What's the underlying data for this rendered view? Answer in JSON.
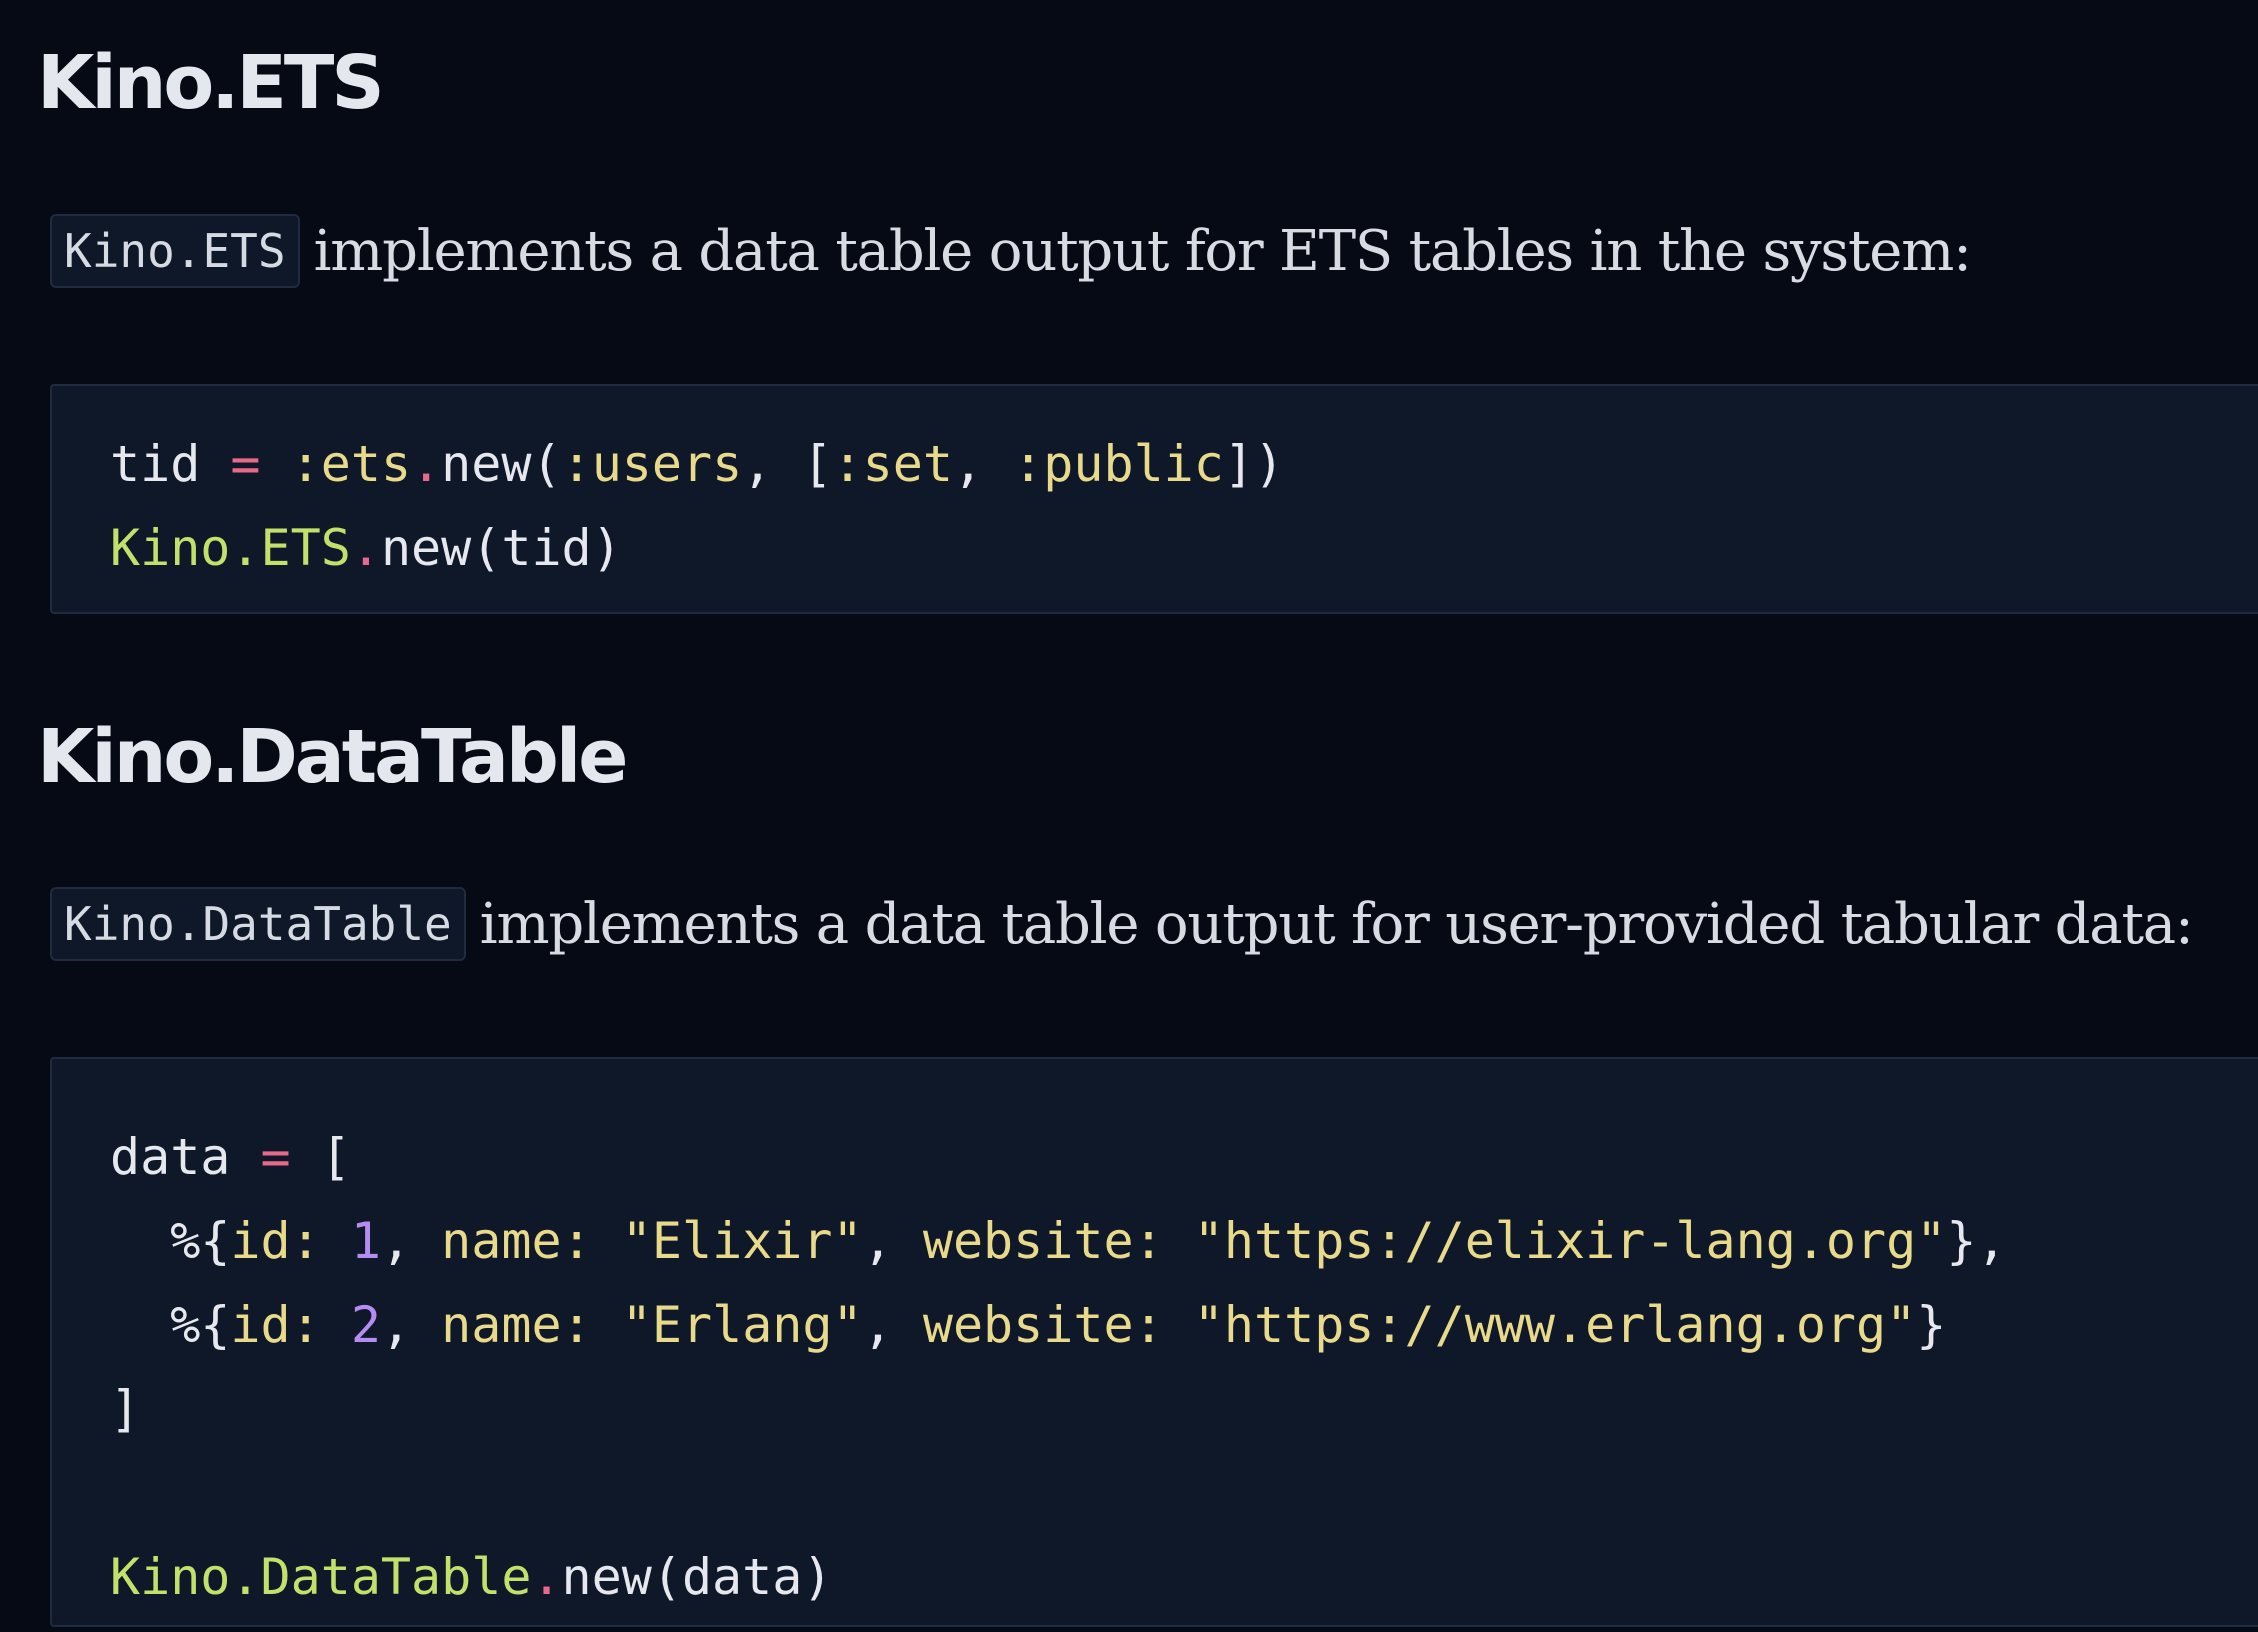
{
  "sections": [
    {
      "heading": "Kino.ETS",
      "inline_code": "Kino.ETS",
      "description": "implements a data table output for ETS tables in the system:",
      "code_lines": [
        [
          {
            "t": "tid",
            "k": "id"
          },
          {
            "t": " ",
            "k": "punc"
          },
          {
            "t": "=",
            "k": "op"
          },
          {
            "t": " ",
            "k": "punc"
          },
          {
            "t": ":ets",
            "k": "atom"
          },
          {
            "t": ".",
            "k": "op"
          },
          {
            "t": "new(",
            "k": "id"
          },
          {
            "t": ":users",
            "k": "atom"
          },
          {
            "t": ", [",
            "k": "punc"
          },
          {
            "t": ":set",
            "k": "atom"
          },
          {
            "t": ", ",
            "k": "punc"
          },
          {
            "t": ":public",
            "k": "atom"
          },
          {
            "t": "])",
            "k": "punc"
          }
        ],
        [
          {
            "t": "Kino.ETS",
            "k": "module"
          },
          {
            "t": ".",
            "k": "op"
          },
          {
            "t": "new(tid)",
            "k": "id"
          }
        ]
      ]
    },
    {
      "heading": "Kino.DataTable",
      "inline_code": "Kino.DataTable",
      "description": "implements a data table output for user-provided tabular data:",
      "code_lines": [
        [
          {
            "t": "data",
            "k": "id"
          },
          {
            "t": " ",
            "k": "punc"
          },
          {
            "t": "=",
            "k": "op"
          },
          {
            "t": " [",
            "k": "punc"
          }
        ],
        [
          {
            "t": "  %{",
            "k": "punc"
          },
          {
            "t": "id:",
            "k": "atom"
          },
          {
            "t": " ",
            "k": "punc"
          },
          {
            "t": "1",
            "k": "num"
          },
          {
            "t": ", ",
            "k": "punc"
          },
          {
            "t": "name:",
            "k": "atom"
          },
          {
            "t": " ",
            "k": "punc"
          },
          {
            "t": "\"Elixir\"",
            "k": "str"
          },
          {
            "t": ", ",
            "k": "punc"
          },
          {
            "t": "website:",
            "k": "atom"
          },
          {
            "t": " ",
            "k": "punc"
          },
          {
            "t": "\"https://elixir-lang.org\"",
            "k": "str"
          },
          {
            "t": "},",
            "k": "punc"
          }
        ],
        [
          {
            "t": "  %{",
            "k": "punc"
          },
          {
            "t": "id:",
            "k": "atom"
          },
          {
            "t": " ",
            "k": "punc"
          },
          {
            "t": "2",
            "k": "num"
          },
          {
            "t": ", ",
            "k": "punc"
          },
          {
            "t": "name:",
            "k": "atom"
          },
          {
            "t": " ",
            "k": "punc"
          },
          {
            "t": "\"Erlang\"",
            "k": "str"
          },
          {
            "t": ", ",
            "k": "punc"
          },
          {
            "t": "website:",
            "k": "atom"
          },
          {
            "t": " ",
            "k": "punc"
          },
          {
            "t": "\"https://www.erlang.org\"",
            "k": "str"
          },
          {
            "t": "}",
            "k": "punc"
          }
        ],
        [
          {
            "t": "]",
            "k": "punc"
          }
        ],
        [],
        [
          {
            "t": "Kino.DataTable",
            "k": "module"
          },
          {
            "t": ".",
            "k": "op"
          },
          {
            "t": "new(data)",
            "k": "id"
          }
        ]
      ]
    }
  ],
  "colors": {
    "background": "#060a14",
    "code_background": "#0f1828",
    "border": "#1f2b40",
    "heading": "#e4e7ee",
    "operator": "#e86a8a",
    "atom_and_string": "#e9d98b",
    "module": "#c2e06a",
    "number": "#b48cf2"
  }
}
